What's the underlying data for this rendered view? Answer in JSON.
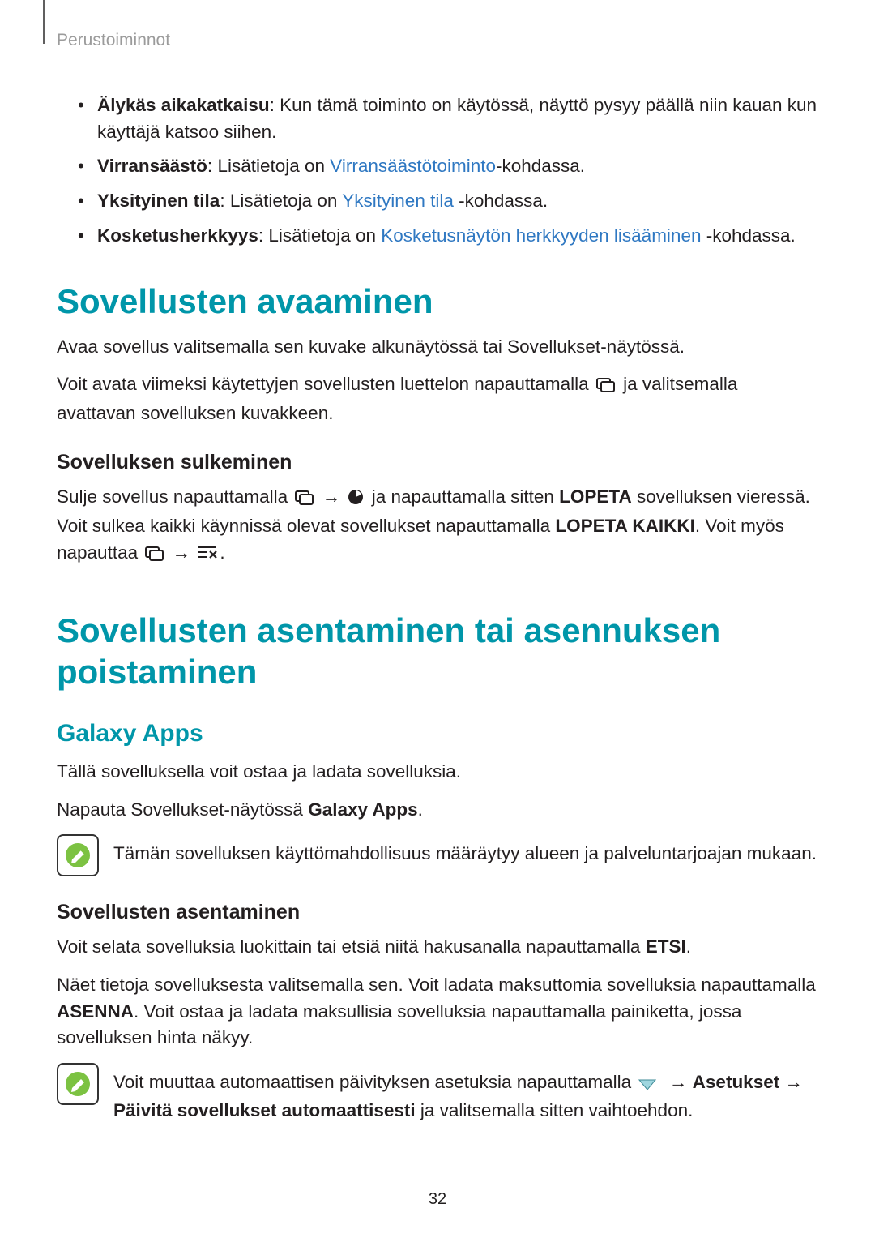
{
  "header": {
    "breadcrumb": "Perustoiminnot"
  },
  "top_list": {
    "item1": {
      "bold": "Älykäs aikakatkaisu",
      "colon": ": ",
      "rest": "Kun tämä toiminto on käytössä, näyttö pysyy päällä niin kauan kun käyttäjä katsoo siihen."
    },
    "item2": {
      "bold": "Virransäästö",
      "colon": ": ",
      "before_link": "Lisätietoja on ",
      "link": "Virransäästötoiminto",
      "after_link": "-kohdassa."
    },
    "item3": {
      "bold": "Yksityinen tila",
      "colon": ": ",
      "before_link": "Lisätietoja on ",
      "link": "Yksityinen tila",
      "after_link": " -kohdassa."
    },
    "item4": {
      "bold": "Kosketusherkkyys",
      "colon": ": ",
      "before_link": "Lisätietoja on ",
      "link": "Kosketusnäytön herkkyyden lisääminen",
      "after_link": " -kohdassa."
    }
  },
  "sec1": {
    "title": "Sovellusten avaaminen",
    "p1": "Avaa sovellus valitsemalla sen kuvake alkunäytössä tai Sovellukset-näytössä.",
    "p2_before": "Voit avata viimeksi käytettyjen sovellusten luettelon napauttamalla ",
    "p2_after": " ja valitsemalla avattavan sovelluksen kuvakkeen.",
    "sub1_title": "Sovelluksen sulkeminen",
    "sub1_p_before": "Sulje sovellus napauttamalla ",
    "sub1_p_mid": " ja napauttamalla sitten ",
    "sub1_lopeta": "LOPETA",
    "sub1_p_mid2": " sovelluksen vieressä. Voit sulkea kaikki käynnissä olevat sovellukset napauttamalla ",
    "sub1_lopetakaikki": "LOPETA KAIKKI",
    "sub1_p_mid3": ". Voit myös napauttaa ",
    "arrow": "→",
    "period": "."
  },
  "sec2": {
    "title": "Sovellusten asentaminen tai asennuksen poistaminen",
    "galaxy_title": "Galaxy Apps",
    "galaxy_p1": "Tällä sovelluksella voit ostaa ja ladata sovelluksia.",
    "galaxy_p2_before": "Napauta Sovellukset-näytössä ",
    "galaxy_p2_bold": "Galaxy Apps",
    "galaxy_p2_after": ".",
    "galaxy_note": "Tämän sovelluksen käyttömahdollisuus määräytyy alueen ja palveluntarjoajan mukaan.",
    "install_title": "Sovellusten asentaminen",
    "install_p1_before": "Voit selata sovelluksia luokittain tai etsiä niitä hakusanalla napauttamalla ",
    "install_p1_bold": "ETSI",
    "install_p1_after": ".",
    "install_p2_before": "Näet tietoja sovelluksesta valitsemalla sen. Voit ladata maksuttomia sovelluksia napauttamalla ",
    "install_p2_asenna": "ASENNA",
    "install_p2_after": ". Voit ostaa ja ladata maksullisia sovelluksia napauttamalla painiketta, jossa sovelluksen hinta näkyy.",
    "install_note_before": "Voit muuttaa automaattisen päivityksen asetuksia napauttamalla ",
    "install_note_asetukset": "Asetukset",
    "install_note_paivita": "Päivitä sovellukset automaattisesti",
    "install_note_after": " ja valitsemalla sitten vaihtoehdon."
  },
  "page_number": "32",
  "icons": {
    "recent": "recent-apps-icon",
    "pie": "pie-task-icon",
    "closeall": "close-all-icon",
    "note": "note-icon",
    "dropdown": "dropdown-triangle-icon"
  }
}
